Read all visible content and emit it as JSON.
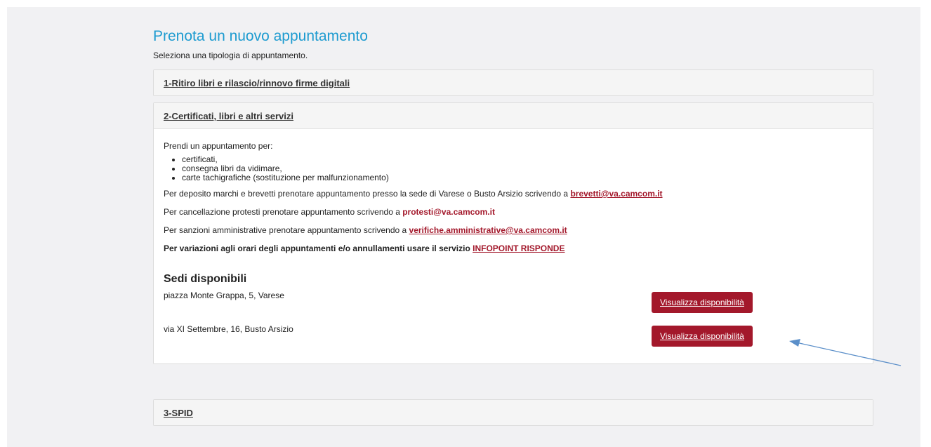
{
  "header": {
    "title": "Prenota un nuovo appuntamento",
    "subtitle": "Seleziona una tipologia di appuntamento."
  },
  "panels": [
    {
      "title": "1-Ritiro libri e rilascio/rinnovo firme digitali"
    },
    {
      "title": "2-Certificati, libri e altri servizi",
      "intro": "Prendi un appuntamento per:",
      "bullets": [
        "certificati,",
        "consegna libri da vidimare,",
        "carte tachigrafiche (sostituzione per malfunzionamento)"
      ],
      "marchi_text": "Per deposito marchi e brevetti prenotare appuntamento presso la sede di Varese o Busto Arsizio scrivendo a ",
      "marchi_email": "brevetti@va.camcom.it",
      "protesti_text": "Per cancellazione protesti prenotare appuntamento scrivendo a ",
      "protesti_email": "protesti@va.camcom.it",
      "sanzioni_text": "Per sanzioni amministrative prenotare appuntamento scrivendo a ",
      "sanzioni_email": "verifiche.amministrative@va.camcom.it",
      "variazioni_text": "Per variazioni agli orari degli appuntamenti e/o annullamenti usare il servizio ",
      "variazioni_link": "INFOPOINT RISPONDE",
      "sedi_title": "Sedi disponibili",
      "sedi": [
        {
          "address": "piazza Monte Grappa, 5, Varese",
          "button": "Visualizza disponibilità"
        },
        {
          "address": "via XI Settembre, 16, Busto Arsizio",
          "button": "Visualizza disponibilità"
        }
      ]
    },
    {
      "title": "3-SPID"
    }
  ],
  "colors": {
    "accent_title": "#1d9bd0",
    "brand_red": "#a3182b",
    "arrow": "#5b8fc9"
  }
}
